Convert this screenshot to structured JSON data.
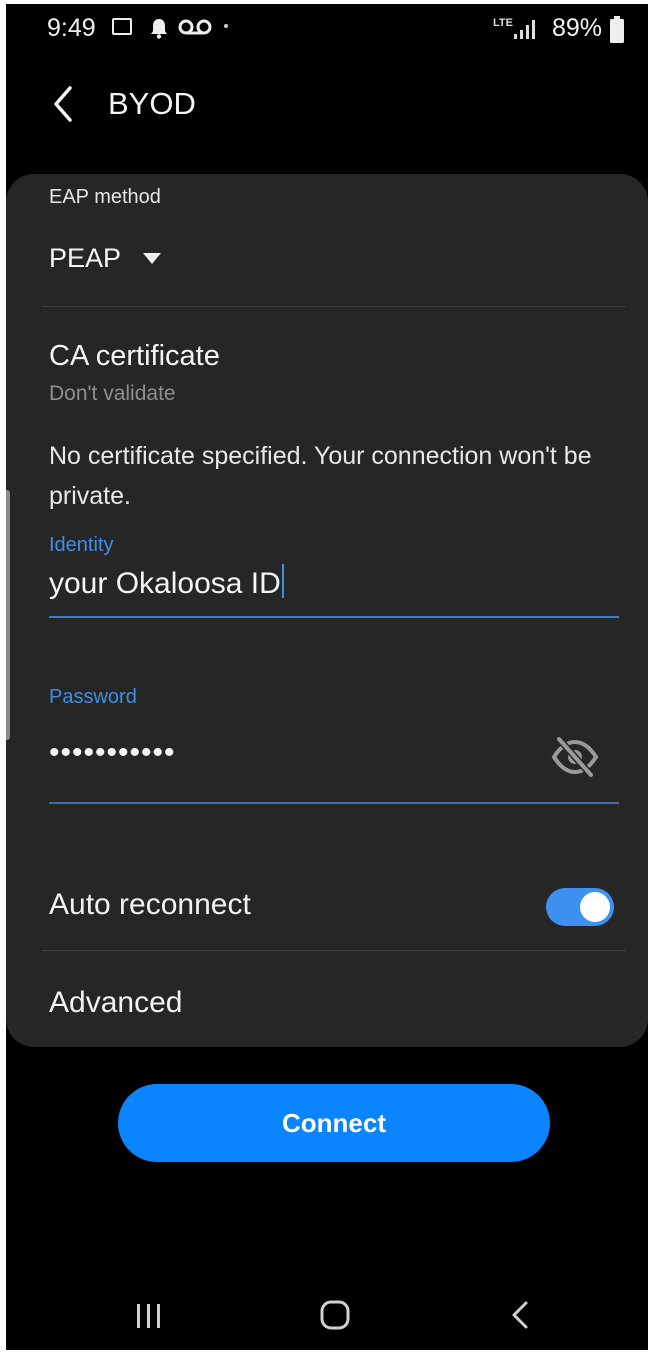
{
  "status_bar": {
    "time": "9:49",
    "network": "LTE",
    "battery": "89%",
    "icons": [
      "gallery-icon",
      "bell-icon",
      "voicemail-icon",
      "signal-icon",
      "battery-icon"
    ]
  },
  "header": {
    "title": "BYOD",
    "back_icon": "chevron-left-icon"
  },
  "form": {
    "eap_method": {
      "label": "EAP method",
      "value": "PEAP"
    },
    "ca_certificate": {
      "title": "CA certificate",
      "value": "Don't validate"
    },
    "warning": "No certificate specified. Your connection won't be private.",
    "identity": {
      "label": "Identity",
      "value": "your Okaloosa ID"
    },
    "password": {
      "label": "Password",
      "value": "•••••••••••",
      "visibility_icon": "eye-off-icon"
    },
    "auto_reconnect": {
      "label": "Auto reconnect",
      "enabled": true
    },
    "advanced": {
      "label": "Advanced"
    }
  },
  "connect_button": {
    "label": "Connect"
  },
  "nav_bar": {
    "icons": [
      "recent-apps-icon",
      "home-icon",
      "back-icon"
    ]
  },
  "colors": {
    "accent": "#3d8fe6",
    "button": "#0a84ff",
    "card": "#262626",
    "background": "#000000"
  }
}
